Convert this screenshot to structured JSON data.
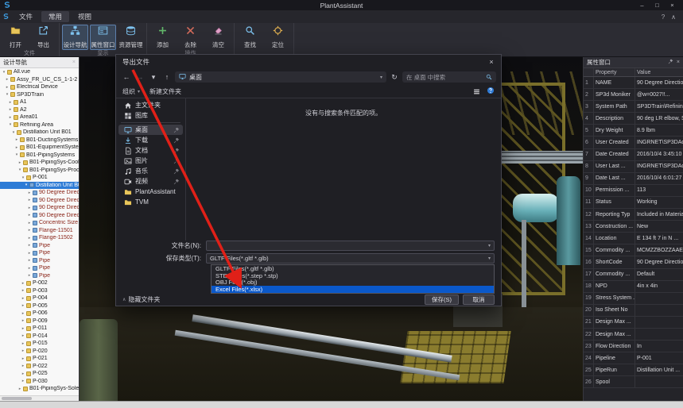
{
  "window": {
    "title": "PlantAssistant",
    "controls": {
      "minimize": "–",
      "maximize": "□",
      "close": "×"
    }
  },
  "ribbon": {
    "tabs": [
      {
        "label": "文件",
        "active": false
      },
      {
        "label": "常用",
        "active": true
      },
      {
        "label": "视图",
        "active": false
      }
    ],
    "groups": [
      {
        "label": "文件",
        "buttons": [
          {
            "label": "打开",
            "icon": "open-icon",
            "active": false
          },
          {
            "label": "导出",
            "icon": "export-icon",
            "active": false
          }
        ]
      },
      {
        "label": "显示",
        "buttons": [
          {
            "label": "设计导航",
            "icon": "design-nav-icon",
            "active": true
          },
          {
            "label": "属性窗口",
            "icon": "property-window-icon",
            "active": true
          },
          {
            "label": "资源管理",
            "icon": "resource-icon",
            "active": false
          }
        ]
      },
      {
        "label": "操作",
        "buttons": [
          {
            "label": "添加",
            "icon": "add-icon",
            "active": false
          },
          {
            "label": "去除",
            "icon": "remove-icon",
            "active": false
          },
          {
            "label": "清空",
            "icon": "clear-icon",
            "active": false
          }
        ]
      },
      {
        "label": "",
        "buttons": [
          {
            "label": "查找",
            "icon": "search-icon",
            "active": false
          },
          {
            "label": "定位",
            "icon": "locate-icon",
            "active": false
          }
        ]
      }
    ]
  },
  "navigator": {
    "title": "设计导航",
    "items": [
      {
        "label": "All.vue",
        "level": 0,
        "state": "expanded",
        "icon": "folder"
      },
      {
        "label": "Assy_FR_UC_CS_1-1-2",
        "level": 1,
        "state": "collapsed",
        "icon": "folder"
      },
      {
        "label": "Electrical Device",
        "level": 1,
        "state": "collapsed",
        "icon": "folder"
      },
      {
        "label": "SP3DTrain",
        "level": 1,
        "state": "expanded",
        "icon": "folder"
      },
      {
        "label": "A1",
        "level": 2,
        "state": "collapsed",
        "icon": "folder"
      },
      {
        "label": "A2",
        "level": 2,
        "state": "collapsed",
        "icon": "folder"
      },
      {
        "label": "Area01",
        "level": 2,
        "state": "collapsed",
        "icon": "folder"
      },
      {
        "label": "Refining Area",
        "level": 2,
        "state": "expanded",
        "icon": "folder"
      },
      {
        "label": "Distillation Unit B01",
        "level": 3,
        "state": "expanded",
        "icon": "folder"
      },
      {
        "label": "B01-DuctingSystems",
        "level": 4,
        "state": "collapsed",
        "icon": "folder"
      },
      {
        "label": "B01-EquipmentSystems",
        "level": 4,
        "state": "collapsed",
        "icon": "folder"
      },
      {
        "label": "B01-PipingSystems",
        "level": 4,
        "state": "expanded",
        "icon": "folder"
      },
      {
        "label": "B01-PipingSys-Cooling Wate...",
        "level": 5,
        "state": "collapsed",
        "icon": "folder"
      },
      {
        "label": "B01-PipingSys-Process",
        "level": 5,
        "state": "expanded",
        "icon": "folder"
      },
      {
        "label": "P-001",
        "level": 6,
        "state": "expanded",
        "icon": "folder"
      },
      {
        "label": "Distillation Unit B01-4-P-1306-...",
        "level": 7,
        "state": "expanded",
        "icon": "part",
        "selected": true
      },
      {
        "label": "90 Degree Direction Change...",
        "level": 8,
        "state": "collapsed",
        "icon": "part",
        "red": true
      },
      {
        "label": "90 Degree Direction Change...",
        "level": 8,
        "state": "collapsed",
        "icon": "part",
        "red": true
      },
      {
        "label": "90 Degree Direction Change...",
        "level": 8,
        "state": "collapsed",
        "icon": "part",
        "red": true
      },
      {
        "label": "90 Degree Direction Change...",
        "level": 8,
        "state": "collapsed",
        "icon": "part",
        "red": true
      },
      {
        "label": "Concentric Size Change-350...",
        "level": 8,
        "state": "collapsed",
        "icon": "part",
        "red": true
      },
      {
        "label": "Flange-11501",
        "level": 8,
        "state": "collapsed",
        "icon": "part",
        "red": true
      },
      {
        "label": "Flange-11502",
        "level": 8,
        "state": "collapsed",
        "icon": "part",
        "red": true
      },
      {
        "label": "Pipe",
        "level": 8,
        "state": "collapsed",
        "icon": "part",
        "red": true
      },
      {
        "label": "Pipe",
        "level": 8,
        "state": "collapsed",
        "icon": "part",
        "red": true
      },
      {
        "label": "Pipe",
        "level": 8,
        "state": "collapsed",
        "icon": "part",
        "red": true
      },
      {
        "label": "Pipe",
        "level": 8,
        "state": "collapsed",
        "icon": "part",
        "red": true
      },
      {
        "label": "Pipe",
        "level": 8,
        "state": "collapsed",
        "icon": "part",
        "red": true
      },
      {
        "label": "P-002",
        "level": 6,
        "state": "collapsed",
        "icon": "folder"
      },
      {
        "label": "P-003",
        "level": 6,
        "state": "collapsed",
        "icon": "folder"
      },
      {
        "label": "P-004",
        "level": 6,
        "state": "collapsed",
        "icon": "folder"
      },
      {
        "label": "P-005",
        "level": 6,
        "state": "collapsed",
        "icon": "folder"
      },
      {
        "label": "P-006",
        "level": 6,
        "state": "collapsed",
        "icon": "folder"
      },
      {
        "label": "P-009",
        "level": 6,
        "state": "collapsed",
        "icon": "folder"
      },
      {
        "label": "P-011",
        "level": 6,
        "state": "collapsed",
        "icon": "folder"
      },
      {
        "label": "P-014",
        "level": 6,
        "state": "collapsed",
        "icon": "folder"
      },
      {
        "label": "P-015",
        "level": 6,
        "state": "collapsed",
        "icon": "folder"
      },
      {
        "label": "P-020",
        "level": 6,
        "state": "collapsed",
        "icon": "folder"
      },
      {
        "label": "P-021",
        "level": 6,
        "state": "collapsed",
        "icon": "folder"
      },
      {
        "label": "P-022",
        "level": 6,
        "state": "collapsed",
        "icon": "folder"
      },
      {
        "label": "P-025",
        "level": 6,
        "state": "collapsed",
        "icon": "folder"
      },
      {
        "label": "P-030",
        "level": 6,
        "state": "collapsed",
        "icon": "folder"
      },
      {
        "label": "B01-PipingSys-Sole...",
        "level": 5,
        "state": "collapsed",
        "icon": "folder"
      }
    ]
  },
  "properties": {
    "title": "属性窗口",
    "columns": [
      "Property",
      "Value"
    ],
    "rows": [
      {
        "num": 1,
        "property": "NAME",
        "value": "90 Degree Directio..."
      },
      {
        "num": 2,
        "property": "SP3d Moniker",
        "value": "@w=0027!!..."
      },
      {
        "num": 3,
        "property": "System Path",
        "value": "SP3DTrain\\Refining ..."
      },
      {
        "num": 4,
        "property": "Description",
        "value": "90 deg LR elbow, S..."
      },
      {
        "num": 5,
        "property": "Dry Weight",
        "value": "8.9 lbm"
      },
      {
        "num": 6,
        "property": "User Created",
        "value": "INGRNET\\SP3DAd..."
      },
      {
        "num": 7,
        "property": "Date Created",
        "value": "2016/10/4 3:45:10"
      },
      {
        "num": 8,
        "property": "User Last ...",
        "value": "INGRNET\\SP3DAd..."
      },
      {
        "num": 9,
        "property": "Date Last ...",
        "value": "2016/10/4 6:01:27"
      },
      {
        "num": 10,
        "property": "Permission ...",
        "value": "113"
      },
      {
        "num": 11,
        "property": "Status",
        "value": "Working"
      },
      {
        "num": 12,
        "property": "Reporting Typ",
        "value": "Included in Materia..."
      },
      {
        "num": 13,
        "property": "Construction ...",
        "value": "New"
      },
      {
        "num": 14,
        "property": "Location",
        "value": "E 134 ft 7 in  N ..."
      },
      {
        "num": 15,
        "property": "Commodity ...",
        "value": "MCMZZBOZZAAEA..."
      },
      {
        "num": 16,
        "property": "ShortCode",
        "value": "90 Degree Directio..."
      },
      {
        "num": 17,
        "property": "Commodity ...",
        "value": "Default"
      },
      {
        "num": 18,
        "property": "NPD",
        "value": "4in x 4in"
      },
      {
        "num": 19,
        "property": "Stress System ...",
        "value": ""
      },
      {
        "num": 20,
        "property": "Iso Sheet No",
        "value": ""
      },
      {
        "num": 21,
        "property": "Design Max ...",
        "value": ""
      },
      {
        "num": 22,
        "property": "Design Max ...",
        "value": ""
      },
      {
        "num": 23,
        "property": "Flow Direction",
        "value": "In"
      },
      {
        "num": 24,
        "property": "Pipeline",
        "value": "P-001"
      },
      {
        "num": 25,
        "property": "PipeRun",
        "value": "Distillation Unit ..."
      },
      {
        "num": 26,
        "property": "Spool",
        "value": ""
      }
    ]
  },
  "dialog": {
    "title": "导出文件",
    "address": "桌面",
    "search_placeholder": "在 桌面 中搜索",
    "toolbar": {
      "organize": "组织",
      "new_folder": "新建文件夹"
    },
    "sidebar": [
      {
        "label": "主文件夹",
        "icon": "home-icon",
        "pinned": false
      },
      {
        "label": "图库",
        "icon": "gallery-icon",
        "pinned": false,
        "separator_after": true
      },
      {
        "label": "桌面",
        "icon": "desktop-icon",
        "pinned": true,
        "selected": true
      },
      {
        "label": "下载",
        "icon": "download-icon",
        "pinned": true
      },
      {
        "label": "文档",
        "icon": "document-icon",
        "pinned": true
      },
      {
        "label": "图片",
        "icon": "pictures-icon",
        "pinned": true
      },
      {
        "label": "音乐",
        "icon": "music-icon",
        "pinned": true
      },
      {
        "label": "视频",
        "icon": "video-icon",
        "pinned": true
      },
      {
        "label": "PlantAssistant",
        "icon": "folder-icon",
        "pinned": false
      },
      {
        "label": "TVM",
        "icon": "folder-icon",
        "pinned": false
      }
    ],
    "empty_message": "没有与搜索条件匹配的项。",
    "file_name_label": "文件名(N):",
    "file_name_value": "",
    "save_type_label": "保存类型(T):",
    "save_type_value": "GLTF Files(*.gltf *.glb)",
    "type_options": [
      {
        "label": "GLTF Files(*.gltf *.glb)",
        "highlighted": false
      },
      {
        "label": "STEP Files(*.step *.stp)",
        "highlighted": false
      },
      {
        "label": "OBJ Files(*.obj)",
        "highlighted": false
      },
      {
        "label": "Excel Files(*.xlsx)",
        "highlighted": true
      }
    ],
    "hide_folders": "隐藏文件夹",
    "save_button": "保存(S)",
    "cancel_button": "取消"
  },
  "colors": {
    "accent": "#2f7bd6",
    "dropdown_highlight": "#0a58ca",
    "tree_selection": "#2e7cd6",
    "tree_red_items": "#8a2418",
    "annotation_arrow": "#e02018"
  }
}
